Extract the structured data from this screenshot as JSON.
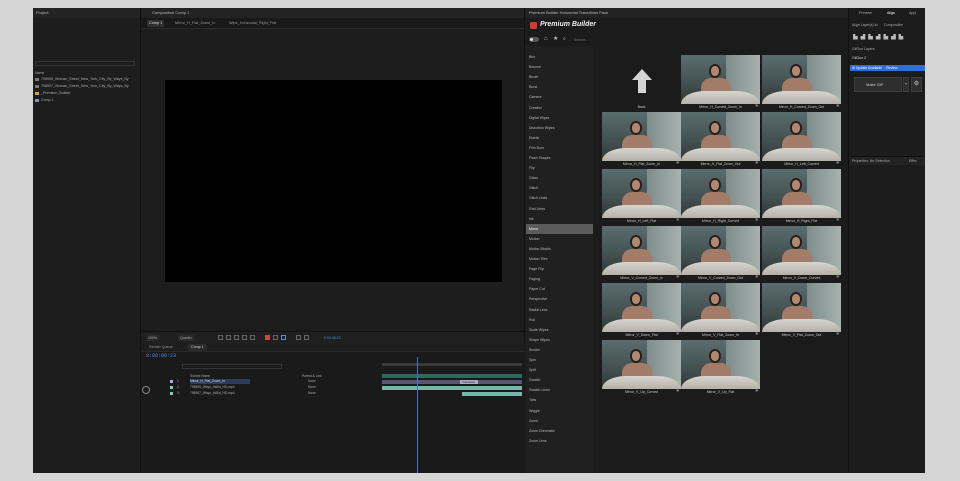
{
  "project": {
    "title": "Project",
    "search_placeholder": "",
    "name_header": "Name",
    "items": [
      "798595_Woman_Street_New_York_City_By_Ways_By",
      "798597_Woman_Street_New_York_City_By_Ways_By",
      "_Premium_Builder",
      "Comp 1"
    ]
  },
  "composition": {
    "panel_title": "Composition Comp 1",
    "tabs": [
      "Comp 1",
      "Mirror_H_Flat_Zoom_In",
      "Wipe_Horizontal_Right_Flat"
    ],
    "zoom": "100%",
    "resolution": "Quarter",
    "timecode": "0:00:06:23"
  },
  "timeline": {
    "tabs": [
      "Render Queue",
      "Comp 1"
    ],
    "timecode": "0:00:06:23",
    "source_header": "Source Name",
    "parent_header": "Parent & Link",
    "parent_value": "None",
    "transition_label": "Transition",
    "layers": [
      {
        "num": "1",
        "name": "Mirror_H_Flat_Zoom_In",
        "color": "#b5a6e0"
      },
      {
        "num": "2",
        "name": "798595_Ways_4k8ld_HD.mp4",
        "color": "#7ecfc0"
      },
      {
        "num": "3",
        "name": "798597_Ways_4k8ld_HD.mp4",
        "color": "#7ecfc0"
      }
    ]
  },
  "plugin": {
    "panel_title": "Premium Builder Horizontal Transitions Pack",
    "title": "Premium Builder",
    "search_placeholder": "Search...",
    "categories": [
      "Blur",
      "Bounce",
      "Brush",
      "Burst",
      "Camera",
      "Creative",
      "Digital Wipes",
      "Distortion Wipes",
      "Elastic",
      "Film Burn",
      "Flash Shapes",
      "Flip",
      "Glass",
      "Glitch",
      "Glitch Lines",
      "Grid Lines",
      "Ink",
      "Mirror",
      "Motion",
      "Motion Blocks",
      "Motion Tiles",
      "Page Flip",
      "Paging",
      "Paper Cut",
      "Perspective",
      "Radial Lens",
      "Roll",
      "Scale Wipes",
      "Shape Wipes",
      "Smoke",
      "Spin",
      "Split",
      "Swatch",
      "Swatch Lines",
      "Tiles",
      "Wiggle",
      "Zoom",
      "Zoom Chromatic",
      "Zoom Lens"
    ],
    "active_category": "Mirror",
    "back_label": "Back",
    "items": [
      "Mirror_H_Curved_Zoom_In",
      "Mirror_H_Curved_Zoom_Out",
      "Mirror_H_Flat_Zoom_In",
      "Mirror_H_Flat_Zoom_Out",
      "Mirror_H_Left_Curved",
      "Mirror_H_Left_Flat",
      "Mirror_H_Right_Curved",
      "Mirror_H_Right_Flat",
      "Mirror_V_Curved_Zoom_In",
      "Mirror_V_Curved_Zoom_Out",
      "Mirror_V_Down_Curved",
      "Mirror_V_Down_Flat",
      "Mirror_V_Flat_Zoom_In",
      "Mirror_V_Flat_Zoom_Out",
      "Mirror_V_Up_Curved",
      "Mirror_V_Up_Flat"
    ]
  },
  "right": {
    "tabs": [
      "Preview",
      "Align",
      "Appl"
    ],
    "align_label": "Align Layer(s) to:",
    "align_value": "Composition",
    "gif_panel": "GifGun Layers",
    "gif_item": "GifGun 2",
    "update_text": "Update Available",
    "update_sub": "Review",
    "make_gif": "Make GIF",
    "props_title": "Properties: No Selection",
    "effects_tab": "Effec"
  }
}
